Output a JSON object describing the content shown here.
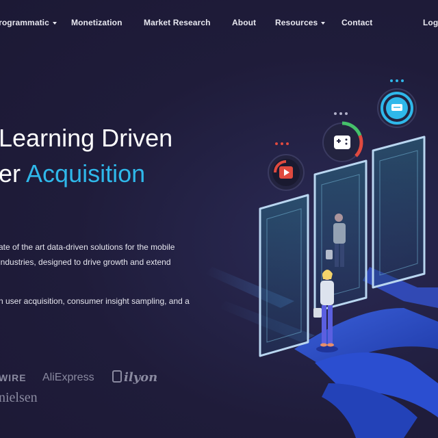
{
  "nav": {
    "items": [
      {
        "label": "Programmatic",
        "dropdown": true
      },
      {
        "label": "Monetization",
        "dropdown": false
      },
      {
        "label": "Market Research",
        "dropdown": false
      },
      {
        "label": "About",
        "dropdown": false
      },
      {
        "label": "Resources",
        "dropdown": true
      },
      {
        "label": "Contact",
        "dropdown": false
      },
      {
        "label": "Log",
        "dropdown": false
      }
    ]
  },
  "hero": {
    "headline_line1": "Learning Driven",
    "headline_line2_prefix": "er ",
    "headline_line2_accent": "Acquisition",
    "para1_line1": "ate of the art data-driven solutions for the mobile",
    "para1_line2": "industries, designed to drive growth and extend",
    "para2_line1": "n user acquisition, consumer insight sampling, and a"
  },
  "logos": {
    "wire": "WIRE",
    "aliexpress": "AliExpress",
    "ilyon": "ilyon",
    "nielsen": "nielsen"
  },
  "colors": {
    "background": "#1f1c3a",
    "accent": "#2fb8ea",
    "text": "#ffffff",
    "logo_gray": "#8a8aa0"
  },
  "icons": [
    "youtube-icon",
    "gamepad-icon",
    "chat-icon",
    "user-group-icon"
  ]
}
